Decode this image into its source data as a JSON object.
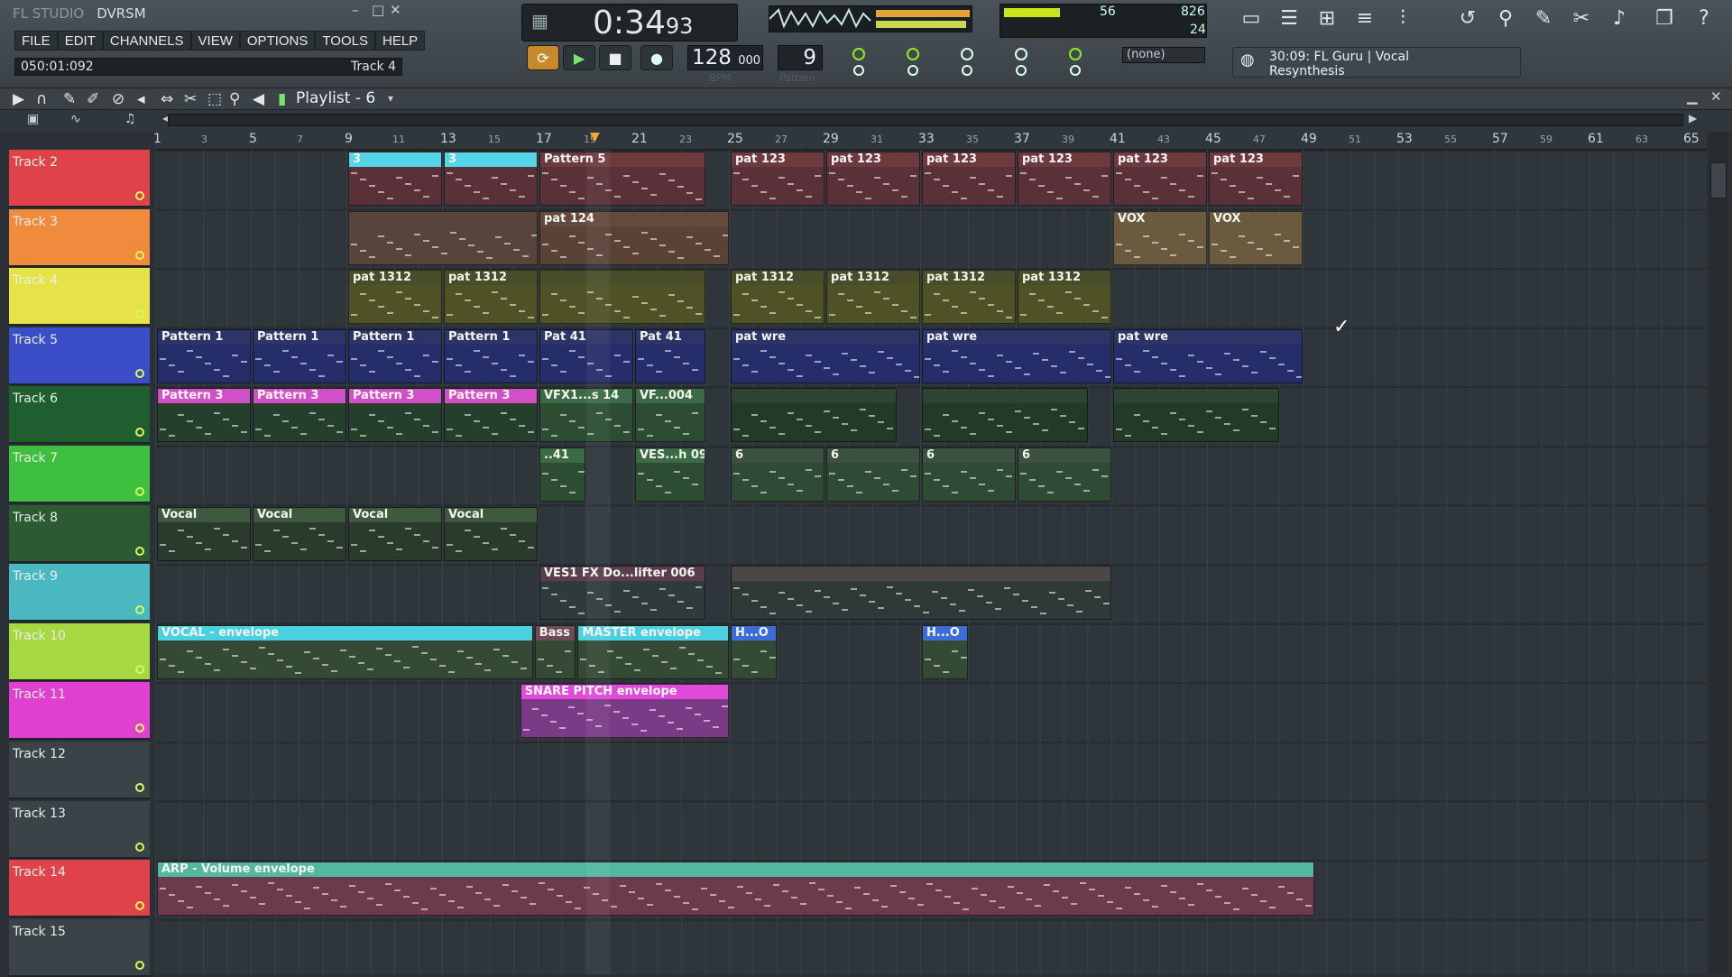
{
  "app": {
    "brand": "FL STUDIO",
    "project": "DVRSM",
    "win_min": "–",
    "win_max": "□",
    "win_close": "✕"
  },
  "menu": [
    "FILE",
    "EDIT",
    "CHANNELS",
    "VIEW",
    "OPTIONS",
    "TOOLS",
    "HELP"
  ],
  "hintbar": {
    "position": "050:01:092",
    "target": "Track 4"
  },
  "clock": {
    "main": "0:34",
    "ms": "93"
  },
  "tempo": {
    "int": "128",
    "dec": "000",
    "label": "BPM"
  },
  "pattern": {
    "value": "9",
    "label": "Pattern"
  },
  "cpu": {
    "a": "56",
    "b": "826",
    "c": "24"
  },
  "snap": "(none)",
  "hint": {
    "line1": "30:09: FL Guru | Vocal",
    "line2": "Resynthesis"
  },
  "playlist": {
    "title": "Playlist - 6"
  },
  "ruler": {
    "major": [
      "1",
      "5",
      "9",
      "13",
      "17",
      "21",
      "25",
      "29",
      "33",
      "37",
      "41",
      "45",
      "49",
      "53",
      "57",
      "61",
      "65"
    ],
    "minor": [
      "3",
      "7",
      "11",
      "15",
      "19",
      "23",
      "27",
      "31",
      "35",
      "39",
      "43",
      "47",
      "51",
      "55",
      "59",
      "63"
    ]
  },
  "colors": {
    "track_red": "#e0424a",
    "track_orange": "#f08a3c",
    "track_yellow": "#e5e347",
    "track_blue": "#3b4ec8",
    "track_dgreen": "#1f5e2e",
    "track_green": "#3fbf3f",
    "track_teal": "#4ab8c0",
    "track_lime": "#a6d842",
    "track_pink": "#e040d0",
    "track_grey": "#3b4348"
  },
  "tracks": [
    {
      "name": "Track 2",
      "color": "#e0424a"
    },
    {
      "name": "Track 3",
      "color": "#f08a3c"
    },
    {
      "name": "Track 4",
      "color": "#e5e347"
    },
    {
      "name": "Track 5",
      "color": "#3b4ec8"
    },
    {
      "name": "Track 6",
      "color": "#1f5e2e"
    },
    {
      "name": "Track 7",
      "color": "#3fbf3f"
    },
    {
      "name": "Track 8",
      "color": "#2b5a33"
    },
    {
      "name": "Track 9",
      "color": "#4ab8c0"
    },
    {
      "name": "Track 10",
      "color": "#a6d842"
    },
    {
      "name": "Track 11",
      "color": "#e040d0"
    },
    {
      "name": "Track 12",
      "color": "#3b4348"
    },
    {
      "name": "Track 13",
      "color": "#3b4348"
    },
    {
      "name": "Track 14",
      "color": "#e0424a"
    },
    {
      "name": "Track 15",
      "color": "#3b4348"
    }
  ],
  "clips": [
    {
      "track": 0,
      "start": 9,
      "end": 13,
      "label": "3",
      "hdr": "#54d6e8",
      "body": "#5a3138"
    },
    {
      "track": 0,
      "start": 13,
      "end": 17,
      "label": "3",
      "hdr": "#54d6e8",
      "body": "#5a3138"
    },
    {
      "track": 0,
      "start": 17,
      "end": 24,
      "label": "Pattern 5",
      "hdr": "#6d3a40",
      "body": "#5a3138"
    },
    {
      "track": 0,
      "start": 25,
      "end": 29,
      "label": "pat 123",
      "hdr": "#6d3a40",
      "body": "#5a3138"
    },
    {
      "track": 0,
      "start": 29,
      "end": 33,
      "label": "pat 123",
      "hdr": "#6d3a40",
      "body": "#5a3138"
    },
    {
      "track": 0,
      "start": 33,
      "end": 37,
      "label": "pat 123",
      "hdr": "#6d3a40",
      "body": "#5a3138"
    },
    {
      "track": 0,
      "start": 37,
      "end": 41,
      "label": "pat 123",
      "hdr": "#6d3a40",
      "body": "#5a3138"
    },
    {
      "track": 0,
      "start": 41,
      "end": 45,
      "label": "pat 123",
      "hdr": "#6d3a40",
      "body": "#5a3138"
    },
    {
      "track": 0,
      "start": 45,
      "end": 49,
      "label": "pat 123",
      "hdr": "#6d3a40",
      "body": "#5a3138"
    },
    {
      "track": 1,
      "start": 9,
      "end": 17,
      "label": "",
      "hdr": "#58443a",
      "body": "#58443a"
    },
    {
      "track": 1,
      "start": 17,
      "end": 25,
      "label": "pat 124",
      "hdr": "#634a3d",
      "body": "#5a4236"
    },
    {
      "track": 1,
      "start": 41,
      "end": 45,
      "label": "VOX",
      "hdr": "#6b5a3e",
      "body": "#6b5a3e"
    },
    {
      "track": 1,
      "start": 45,
      "end": 49,
      "label": "VOX",
      "hdr": "#6b5a3e",
      "body": "#6b5a3e"
    },
    {
      "track": 2,
      "start": 9,
      "end": 13,
      "label": "pat 1312",
      "hdr": "#4a4d2a",
      "body": "#4e5224"
    },
    {
      "track": 2,
      "start": 13,
      "end": 17,
      "label": "pat 1312",
      "hdr": "#4a4d2a",
      "body": "#4e5224"
    },
    {
      "track": 2,
      "start": 17,
      "end": 24,
      "label": "",
      "hdr": "#4a4d2a",
      "body": "#4e5224"
    },
    {
      "track": 2,
      "start": 25,
      "end": 29,
      "label": "pat 1312",
      "hdr": "#4a4d2a",
      "body": "#4e5224"
    },
    {
      "track": 2,
      "start": 29,
      "end": 33,
      "label": "pat 1312",
      "hdr": "#4a4d2a",
      "body": "#4e5224"
    },
    {
      "track": 2,
      "start": 33,
      "end": 37,
      "label": "pat 1312",
      "hdr": "#4a4d2a",
      "body": "#4e5224"
    },
    {
      "track": 2,
      "start": 37,
      "end": 41,
      "label": "pat 1312",
      "hdr": "#4a4d2a",
      "body": "#4e5224"
    },
    {
      "track": 3,
      "start": 1,
      "end": 5,
      "label": "Pattern 1",
      "hdr": "#2c3566",
      "body": "#252d6a"
    },
    {
      "track": 3,
      "start": 5,
      "end": 9,
      "label": "Pattern 1",
      "hdr": "#2c3566",
      "body": "#252d6a"
    },
    {
      "track": 3,
      "start": 9,
      "end": 13,
      "label": "Pattern 1",
      "hdr": "#2c3566",
      "body": "#252d6a"
    },
    {
      "track": 3,
      "start": 13,
      "end": 17,
      "label": "Pattern 1",
      "hdr": "#2c3566",
      "body": "#252d6a"
    },
    {
      "track": 3,
      "start": 17,
      "end": 21,
      "label": "Pat 41",
      "hdr": "#2c3566",
      "body": "#252d6a"
    },
    {
      "track": 3,
      "start": 21,
      "end": 24,
      "label": "Pat 41",
      "hdr": "#2c3566",
      "body": "#252d6a"
    },
    {
      "track": 3,
      "start": 25,
      "end": 33,
      "label": "pat wre",
      "hdr": "#2c3566",
      "body": "#252d6a"
    },
    {
      "track": 3,
      "start": 33,
      "end": 41,
      "label": "pat wre",
      "hdr": "#2c3566",
      "body": "#252d6a"
    },
    {
      "track": 3,
      "start": 41,
      "end": 49,
      "label": "pat wre",
      "hdr": "#2c3566",
      "body": "#252d6a"
    },
    {
      "track": 4,
      "start": 1,
      "end": 5,
      "label": "Pattern 3",
      "hdr": "#d24fc8",
      "body": "#243f2c"
    },
    {
      "track": 4,
      "start": 5,
      "end": 9,
      "label": "Pattern 3",
      "hdr": "#d24fc8",
      "body": "#243f2c"
    },
    {
      "track": 4,
      "start": 9,
      "end": 13,
      "label": "Pattern 3",
      "hdr": "#d24fc8",
      "body": "#243f2c"
    },
    {
      "track": 4,
      "start": 13,
      "end": 17,
      "label": "Pattern 3",
      "hdr": "#d24fc8",
      "body": "#243f2c"
    },
    {
      "track": 4,
      "start": 17,
      "end": 21,
      "label": "VFX1...s 14",
      "hdr": "#3c6a44",
      "body": "#2c4d32"
    },
    {
      "track": 4,
      "start": 21,
      "end": 24,
      "label": "VF...004",
      "hdr": "#3c6a44",
      "body": "#2c4d32"
    },
    {
      "track": 4,
      "start": 25,
      "end": 32,
      "label": "",
      "hdr": "#2e4432",
      "body": "#243a28"
    },
    {
      "track": 4,
      "start": 33,
      "end": 40,
      "label": "",
      "hdr": "#2e4432",
      "body": "#243a28"
    },
    {
      "track": 4,
      "start": 41,
      "end": 48,
      "label": "",
      "hdr": "#2e4432",
      "body": "#243a28"
    },
    {
      "track": 5,
      "start": 17,
      "end": 19,
      "label": "..41",
      "hdr": "#3c6a44",
      "body": "#2c4d32"
    },
    {
      "track": 5,
      "start": 21,
      "end": 24,
      "label": "VES...h 09",
      "hdr": "#3c6a44",
      "body": "#2c4d32"
    },
    {
      "track": 5,
      "start": 25,
      "end": 29,
      "label": "6",
      "hdr": "#3b5240",
      "body": "#2f4a35"
    },
    {
      "track": 5,
      "start": 29,
      "end": 33,
      "label": "6",
      "hdr": "#3b5240",
      "body": "#2f4a35"
    },
    {
      "track": 5,
      "start": 33,
      "end": 37,
      "label": "6",
      "hdr": "#3b5240",
      "body": "#2f4a35"
    },
    {
      "track": 5,
      "start": 37,
      "end": 41,
      "label": "6",
      "hdr": "#3b5240",
      "body": "#2f4a35"
    },
    {
      "track": 6,
      "start": 1,
      "end": 5,
      "label": "Vocal",
      "hdr": "#3f5840",
      "body": "#2a3a2c"
    },
    {
      "track": 6,
      "start": 5,
      "end": 9,
      "label": "Vocal",
      "hdr": "#3f5840",
      "body": "#2a3a2c"
    },
    {
      "track": 6,
      "start": 9,
      "end": 13,
      "label": "Vocal",
      "hdr": "#3f5840",
      "body": "#2a3a2c"
    },
    {
      "track": 6,
      "start": 13,
      "end": 17,
      "label": "Vocal",
      "hdr": "#3f5840",
      "body": "#2a3a2c"
    },
    {
      "track": 7,
      "start": 17,
      "end": 24,
      "label": "VES1 FX Do...lifter 006",
      "hdr": "#5a3e4e",
      "body": "#2e3a3c"
    },
    {
      "track": 7,
      "start": 25,
      "end": 41,
      "label": "",
      "hdr": "#4d4646",
      "body": "#2f3a38"
    },
    {
      "track": 8,
      "start": 1,
      "end": 16.8,
      "label": "VOCAL - envelope",
      "hdr": "#4bd0e2",
      "body": "#344a34"
    },
    {
      "track": 8,
      "start": 16.8,
      "end": 18.6,
      "label": "Bass -",
      "hdr": "#6d4a56",
      "body": "#344a34"
    },
    {
      "track": 8,
      "start": 18.6,
      "end": 25,
      "label": "MASTER envelope",
      "hdr": "#4bd0e2",
      "body": "#344a34"
    },
    {
      "track": 8,
      "start": 25,
      "end": 27,
      "label": "H...O",
      "hdr": "#3d6bd8",
      "body": "#344a34"
    },
    {
      "track": 8,
      "start": 33,
      "end": 35,
      "label": "H...O",
      "hdr": "#3d6bd8",
      "body": "#344a34"
    },
    {
      "track": 9,
      "start": 16.2,
      "end": 25,
      "label": "SNARE PITCH envelope",
      "hdr": "#e04ad8",
      "body": "#7a3a86"
    },
    {
      "track": 12,
      "start": 1,
      "end": 49.5,
      "label": "ARP - Volume envelope",
      "hdr": "#54b8a0",
      "body": "#6b3a4c"
    }
  ]
}
